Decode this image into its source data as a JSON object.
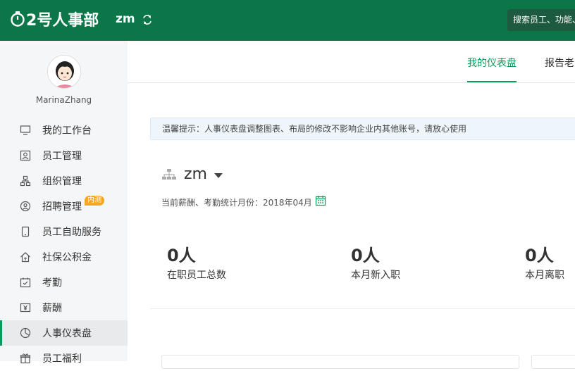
{
  "header": {
    "logo_text": "2号人事部",
    "company": "zm",
    "search_placeholder": "搜索员工、功能、"
  },
  "user": {
    "name": "MarinaZhang"
  },
  "sidebar": {
    "items": [
      {
        "label": "我的工作台",
        "icon": "monitor-icon"
      },
      {
        "label": "员工管理",
        "icon": "user-card-icon"
      },
      {
        "label": "组织管理",
        "icon": "org-icon"
      },
      {
        "label": "招聘管理",
        "icon": "recruit-icon",
        "badge": "内测"
      },
      {
        "label": "员工自助服务",
        "icon": "phone-icon"
      },
      {
        "label": "社保公积金",
        "icon": "house-icon"
      },
      {
        "label": "考勤",
        "icon": "calendar-check-icon"
      },
      {
        "label": "薪酬",
        "icon": "yen-icon"
      },
      {
        "label": "人事仪表盘",
        "icon": "dashboard-icon",
        "active": true
      },
      {
        "label": "员工福利",
        "icon": "gift-icon"
      }
    ]
  },
  "tabs": [
    {
      "label": "我的仪表盘",
      "active": true
    },
    {
      "label": "报告老"
    }
  ],
  "tip": "温馨提示：人事仪表盘调整图表、布局的修改不影响企业内其他账号，请放心使用",
  "org": {
    "name": "zm",
    "stat_month": "当前薪酬、考勤统计月份：2018年04月"
  },
  "kpis": [
    {
      "value": "0人",
      "label": "在职员工总数"
    },
    {
      "value": "0人",
      "label": "本月新入职"
    },
    {
      "value": "0人",
      "label": "本月离职"
    }
  ],
  "colors": {
    "brand": "#0b7748",
    "accent": "#0b9a5a",
    "badge": "#f5a623"
  }
}
